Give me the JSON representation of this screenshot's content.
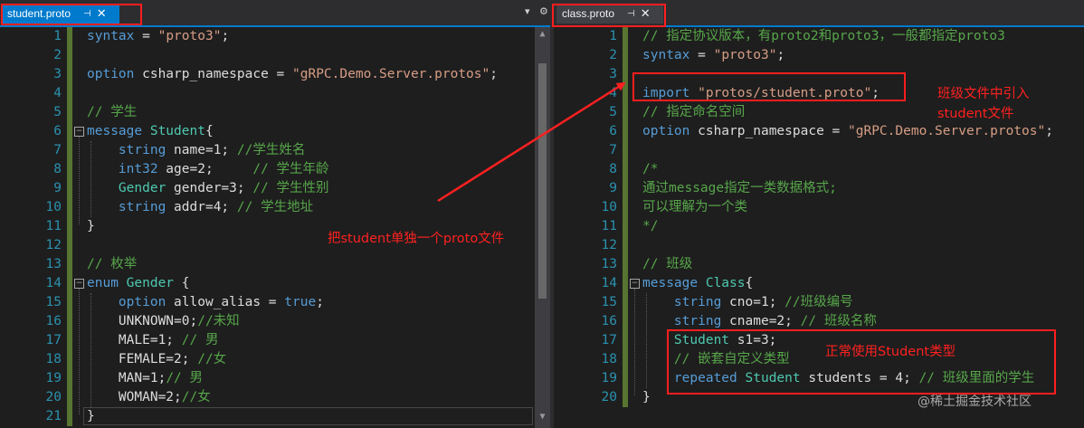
{
  "left_tab": {
    "title": "student.proto",
    "pin": "⊣",
    "close": "✕"
  },
  "right_tab": {
    "title": "class.proto",
    "pin": "⊣",
    "close": "✕"
  },
  "left_toolbar": {
    "dropdown": "▾",
    "settings": "⚙"
  },
  "scroll_arrows": {
    "up": "▲",
    "down": "▼"
  },
  "left_editor": {
    "line_numbers": [
      "1",
      "2",
      "3",
      "4",
      "5",
      "6",
      "7",
      "8",
      "9",
      "10",
      "11",
      "12",
      "13",
      "14",
      "15",
      "16",
      "17",
      "18",
      "19",
      "20",
      "21"
    ],
    "lines": [
      [
        {
          "t": "kw",
          "v": "syntax"
        },
        {
          "t": "txt",
          "v": " = "
        },
        {
          "t": "str",
          "v": "\"proto3\""
        },
        {
          "t": "txt",
          "v": ";"
        }
      ],
      [],
      [
        {
          "t": "kw",
          "v": "option"
        },
        {
          "t": "txt",
          "v": " csharp_namespace = "
        },
        {
          "t": "str",
          "v": "\"gRPC.Demo.Server.protos\""
        },
        {
          "t": "txt",
          "v": ";"
        }
      ],
      [],
      [
        {
          "t": "cmt",
          "v": "// 学生"
        }
      ],
      [
        {
          "t": "kw",
          "v": "message"
        },
        {
          "t": "txt",
          "v": " "
        },
        {
          "t": "typ",
          "v": "Student"
        },
        {
          "t": "txt",
          "v": "{"
        }
      ],
      [
        {
          "t": "txt",
          "v": "    "
        },
        {
          "t": "kw",
          "v": "string"
        },
        {
          "t": "txt",
          "v": " name=1; "
        },
        {
          "t": "cmt",
          "v": "//学生姓名"
        }
      ],
      [
        {
          "t": "txt",
          "v": "    "
        },
        {
          "t": "kw",
          "v": "int32"
        },
        {
          "t": "txt",
          "v": " age=2;     "
        },
        {
          "t": "cmt",
          "v": "// 学生年龄"
        }
      ],
      [
        {
          "t": "txt",
          "v": "    "
        },
        {
          "t": "typ",
          "v": "Gender"
        },
        {
          "t": "txt",
          "v": " gender=3; "
        },
        {
          "t": "cmt",
          "v": "// 学生性别"
        }
      ],
      [
        {
          "t": "txt",
          "v": "    "
        },
        {
          "t": "kw",
          "v": "string"
        },
        {
          "t": "txt",
          "v": " addr=4; "
        },
        {
          "t": "cmt",
          "v": "// 学生地址"
        }
      ],
      [
        {
          "t": "txt",
          "v": "}"
        }
      ],
      [],
      [
        {
          "t": "cmt",
          "v": "// 枚举"
        }
      ],
      [
        {
          "t": "kw",
          "v": "enum"
        },
        {
          "t": "txt",
          "v": " "
        },
        {
          "t": "typ",
          "v": "Gender"
        },
        {
          "t": "txt",
          "v": " {"
        }
      ],
      [
        {
          "t": "txt",
          "v": "    "
        },
        {
          "t": "kw",
          "v": "option"
        },
        {
          "t": "txt",
          "v": " allow_alias = "
        },
        {
          "t": "kw",
          "v": "true"
        },
        {
          "t": "txt",
          "v": ";"
        }
      ],
      [
        {
          "t": "txt",
          "v": "    UNKNOWN=0;"
        },
        {
          "t": "cmt",
          "v": "//未知"
        }
      ],
      [
        {
          "t": "txt",
          "v": "    MALE=1; "
        },
        {
          "t": "cmt",
          "v": "// 男"
        }
      ],
      [
        {
          "t": "txt",
          "v": "    FEMALE=2; "
        },
        {
          "t": "cmt",
          "v": "//女"
        }
      ],
      [
        {
          "t": "txt",
          "v": "    MAN=1;"
        },
        {
          "t": "cmt",
          "v": "// 男"
        }
      ],
      [
        {
          "t": "txt",
          "v": "    WOMAN=2;"
        },
        {
          "t": "cmt",
          "v": "//女"
        }
      ],
      [
        {
          "t": "txt",
          "v": "}"
        }
      ]
    ]
  },
  "right_editor": {
    "line_numbers": [
      "1",
      "2",
      "3",
      "4",
      "5",
      "6",
      "7",
      "8",
      "9",
      "10",
      "11",
      "12",
      "13",
      "14",
      "15",
      "16",
      "17",
      "18",
      "19",
      "20"
    ],
    "lines": [
      [
        {
          "t": "cmt",
          "v": "// 指定协议版本，有proto2和proto3，一般都指定proto3"
        }
      ],
      [
        {
          "t": "kw",
          "v": "syntax"
        },
        {
          "t": "txt",
          "v": " = "
        },
        {
          "t": "str",
          "v": "\"proto3\""
        },
        {
          "t": "txt",
          "v": ";"
        }
      ],
      [],
      [
        {
          "t": "kw",
          "v": "import"
        },
        {
          "t": "txt",
          "v": " "
        },
        {
          "t": "str",
          "v": "\"protos/student.proto\""
        },
        {
          "t": "txt",
          "v": ";"
        }
      ],
      [
        {
          "t": "cmt",
          "v": "// 指定命名空间"
        }
      ],
      [
        {
          "t": "kw",
          "v": "option"
        },
        {
          "t": "txt",
          "v": " csharp_namespace = "
        },
        {
          "t": "str",
          "v": "\"gRPC.Demo.Server.protos\""
        },
        {
          "t": "txt",
          "v": ";"
        }
      ],
      [],
      [
        {
          "t": "cmt",
          "v": "/*"
        }
      ],
      [
        {
          "t": "cmt",
          "v": "通过message指定一类数据格式;"
        }
      ],
      [
        {
          "t": "cmt",
          "v": "可以理解为一个类"
        }
      ],
      [
        {
          "t": "cmt",
          "v": "*/"
        }
      ],
      [],
      [
        {
          "t": "cmt",
          "v": "// 班级"
        }
      ],
      [
        {
          "t": "kw",
          "v": "message"
        },
        {
          "t": "txt",
          "v": " "
        },
        {
          "t": "typ",
          "v": "Class"
        },
        {
          "t": "txt",
          "v": "{"
        }
      ],
      [
        {
          "t": "txt",
          "v": "    "
        },
        {
          "t": "kw",
          "v": "string"
        },
        {
          "t": "txt",
          "v": " cno=1; "
        },
        {
          "t": "cmt",
          "v": "//班级编号"
        }
      ],
      [
        {
          "t": "txt",
          "v": "    "
        },
        {
          "t": "kw",
          "v": "string"
        },
        {
          "t": "txt",
          "v": " cname=2; "
        },
        {
          "t": "cmt",
          "v": "// 班级名称"
        }
      ],
      [
        {
          "t": "txt",
          "v": "    "
        },
        {
          "t": "typ",
          "v": "Student"
        },
        {
          "t": "txt",
          "v": " s1=3;"
        }
      ],
      [
        {
          "t": "txt",
          "v": "    "
        },
        {
          "t": "cmt",
          "v": "// 嵌套自定义类型"
        }
      ],
      [
        {
          "t": "txt",
          "v": "    "
        },
        {
          "t": "kw",
          "v": "repeated"
        },
        {
          "t": "txt",
          "v": " "
        },
        {
          "t": "typ",
          "v": "Student"
        },
        {
          "t": "txt",
          "v": " students = 4; "
        },
        {
          "t": "cmt",
          "v": "// 班级里面的学生"
        }
      ],
      [
        {
          "t": "txt",
          "v": "}"
        }
      ]
    ]
  },
  "annotations": {
    "left_note": "把student单独一个proto文件",
    "import_note": "班级文件中引入\nstudent文件",
    "usage_note": "正常使用Student类型"
  },
  "watermark": "@稀土掘金技术社区",
  "colors": {
    "annotation": "#ff2020",
    "tab_active": "#007acc",
    "keyword": "#569cd6",
    "string": "#d69d85",
    "comment": "#57a64a",
    "type": "#4ec9b0"
  }
}
